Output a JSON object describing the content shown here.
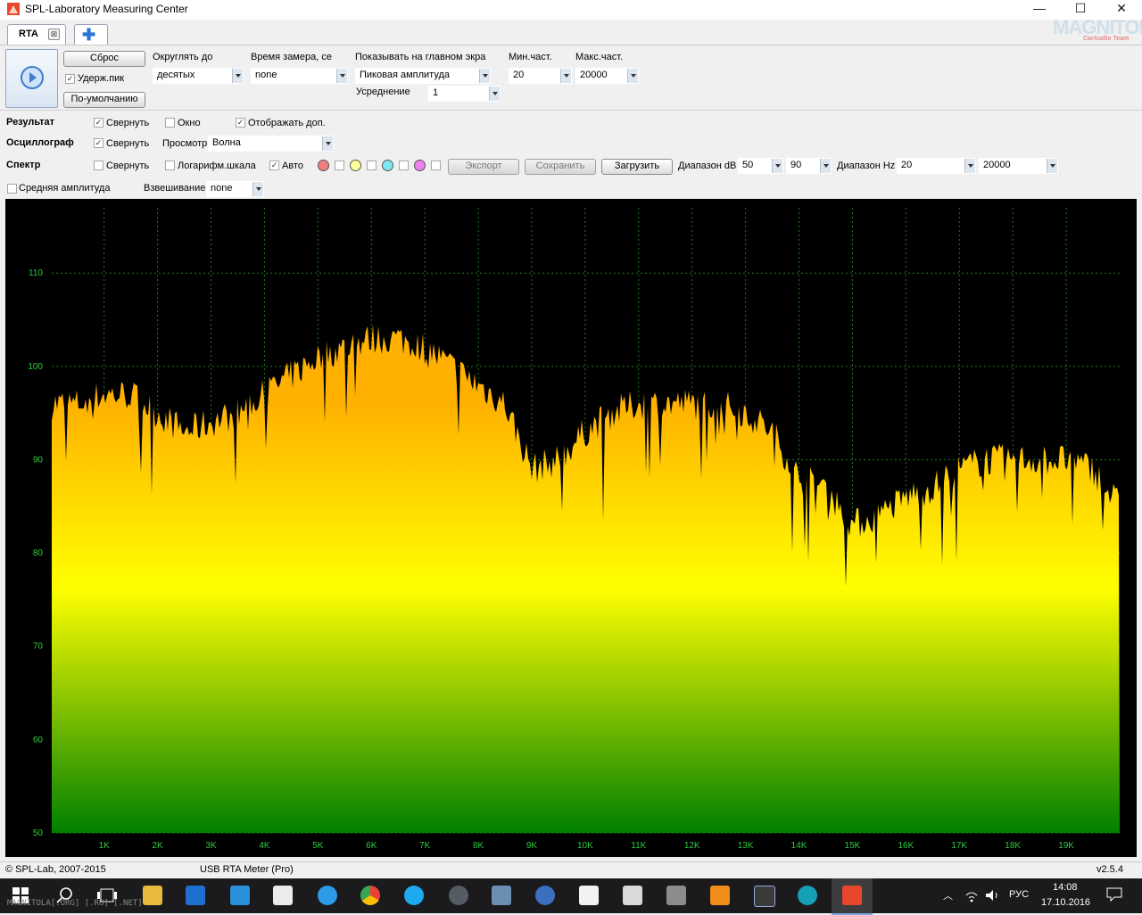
{
  "window": {
    "title": "SPL-Laboratory Measuring Center",
    "minimize": "—",
    "maximize": "☐",
    "close": "✕"
  },
  "tabs": {
    "active_label": "RTA",
    "close_glyph": "⊠",
    "add_glyph": "✚"
  },
  "logo": {
    "main": "MAGNITOLA",
    "sub": "CarAudio Team"
  },
  "toolbar": {
    "reset_label": "Сброс",
    "hold_peak_label": "Удерж.пик",
    "defaults_label": "По-умолчанию",
    "round_label": "Округлять до",
    "round_value": "десятых",
    "measure_time_label": "Время замера, се",
    "measure_time_value": "none",
    "main_display_label": "Показывать на главном экра",
    "main_display_value": "Пиковая амплитуда",
    "averaging_label": "Усреднение",
    "averaging_value": "1",
    "min_freq_label": "Мин.част.",
    "min_freq_value": "20",
    "max_freq_label": "Макс.част.",
    "max_freq_value": "20000"
  },
  "options": {
    "result": {
      "label": "Результат",
      "collapse": "Свернуть",
      "window": "Окно",
      "show_extra": "Отображать доп."
    },
    "oscillograph": {
      "label": "Осциллограф",
      "collapse": "Свернуть",
      "view_label": "Просмотр",
      "view_value": "Волна"
    },
    "spectrum": {
      "label": "Спектр",
      "collapse": "Свернуть",
      "log_scale": "Логарифм.шкала",
      "auto": "Авто",
      "export": "Экспорт",
      "save": "Сохранить",
      "load": "Загрузить",
      "db_range_label": "Диапазон dB",
      "db_min": "50",
      "db_max": "90",
      "hz_range_label": "Диапазон Hz",
      "hz_min": "20",
      "hz_max": "20000"
    },
    "avg_amplitude": "Средняя амплитуда",
    "weighting_label": "Взвешивание",
    "weighting_value": "none",
    "swatch_colors": [
      "#f08080",
      "#ffff99",
      "#7fe8ef",
      "#ee82ee"
    ]
  },
  "chart_data": {
    "type": "area",
    "y_ticks": [
      "50",
      "60",
      "70",
      "80",
      "90",
      "100",
      "110"
    ],
    "ylim": [
      50,
      117
    ],
    "x_ticks": [
      "1K",
      "2K",
      "3K",
      "4K",
      "5K",
      "6K",
      "7K",
      "8K",
      "9K",
      "10K",
      "11K",
      "12K",
      "13K",
      "14K",
      "15K",
      "16K",
      "17K",
      "18K",
      "19K"
    ],
    "xlim": [
      20,
      20000
    ],
    "grid": true,
    "gradient_colors": [
      "#ffb000",
      "#ffff00",
      "#008000"
    ],
    "series": [
      {
        "x": [
          20,
          500,
          1000,
          1500,
          2000,
          2500,
          3000,
          3500,
          4000,
          4500,
          5000,
          5500,
          6000,
          6500,
          7000,
          7500,
          8000,
          8500,
          9000,
          9500,
          10000,
          10500,
          11000,
          11500,
          12000,
          12500,
          13000,
          13500,
          14000,
          14500,
          15000,
          15500,
          16000,
          16500,
          17000,
          17500,
          18000,
          18500,
          19000,
          19500,
          20000
        ],
        "y": [
          96,
          96,
          97,
          97,
          95,
          93,
          94,
          95,
          97,
          99,
          101,
          102,
          103,
          103,
          102,
          100,
          98,
          96,
          89,
          90,
          93,
          95,
          96,
          96,
          96,
          96,
          95,
          93,
          88,
          87,
          83,
          84,
          86,
          87,
          89,
          90,
          90,
          90,
          90,
          89,
          85
        ]
      }
    ]
  },
  "statusbar": {
    "copyright": "© SPL-Lab, 2007-2015",
    "device": "USB RTA Meter (Pro)",
    "version": "v2.5.4"
  },
  "taskbar": {
    "lang": "РУС",
    "time": "14:08",
    "date": "17.10.2016",
    "watermark": "MAGNITOLA[.ORG] [.RU] [.NET]"
  }
}
